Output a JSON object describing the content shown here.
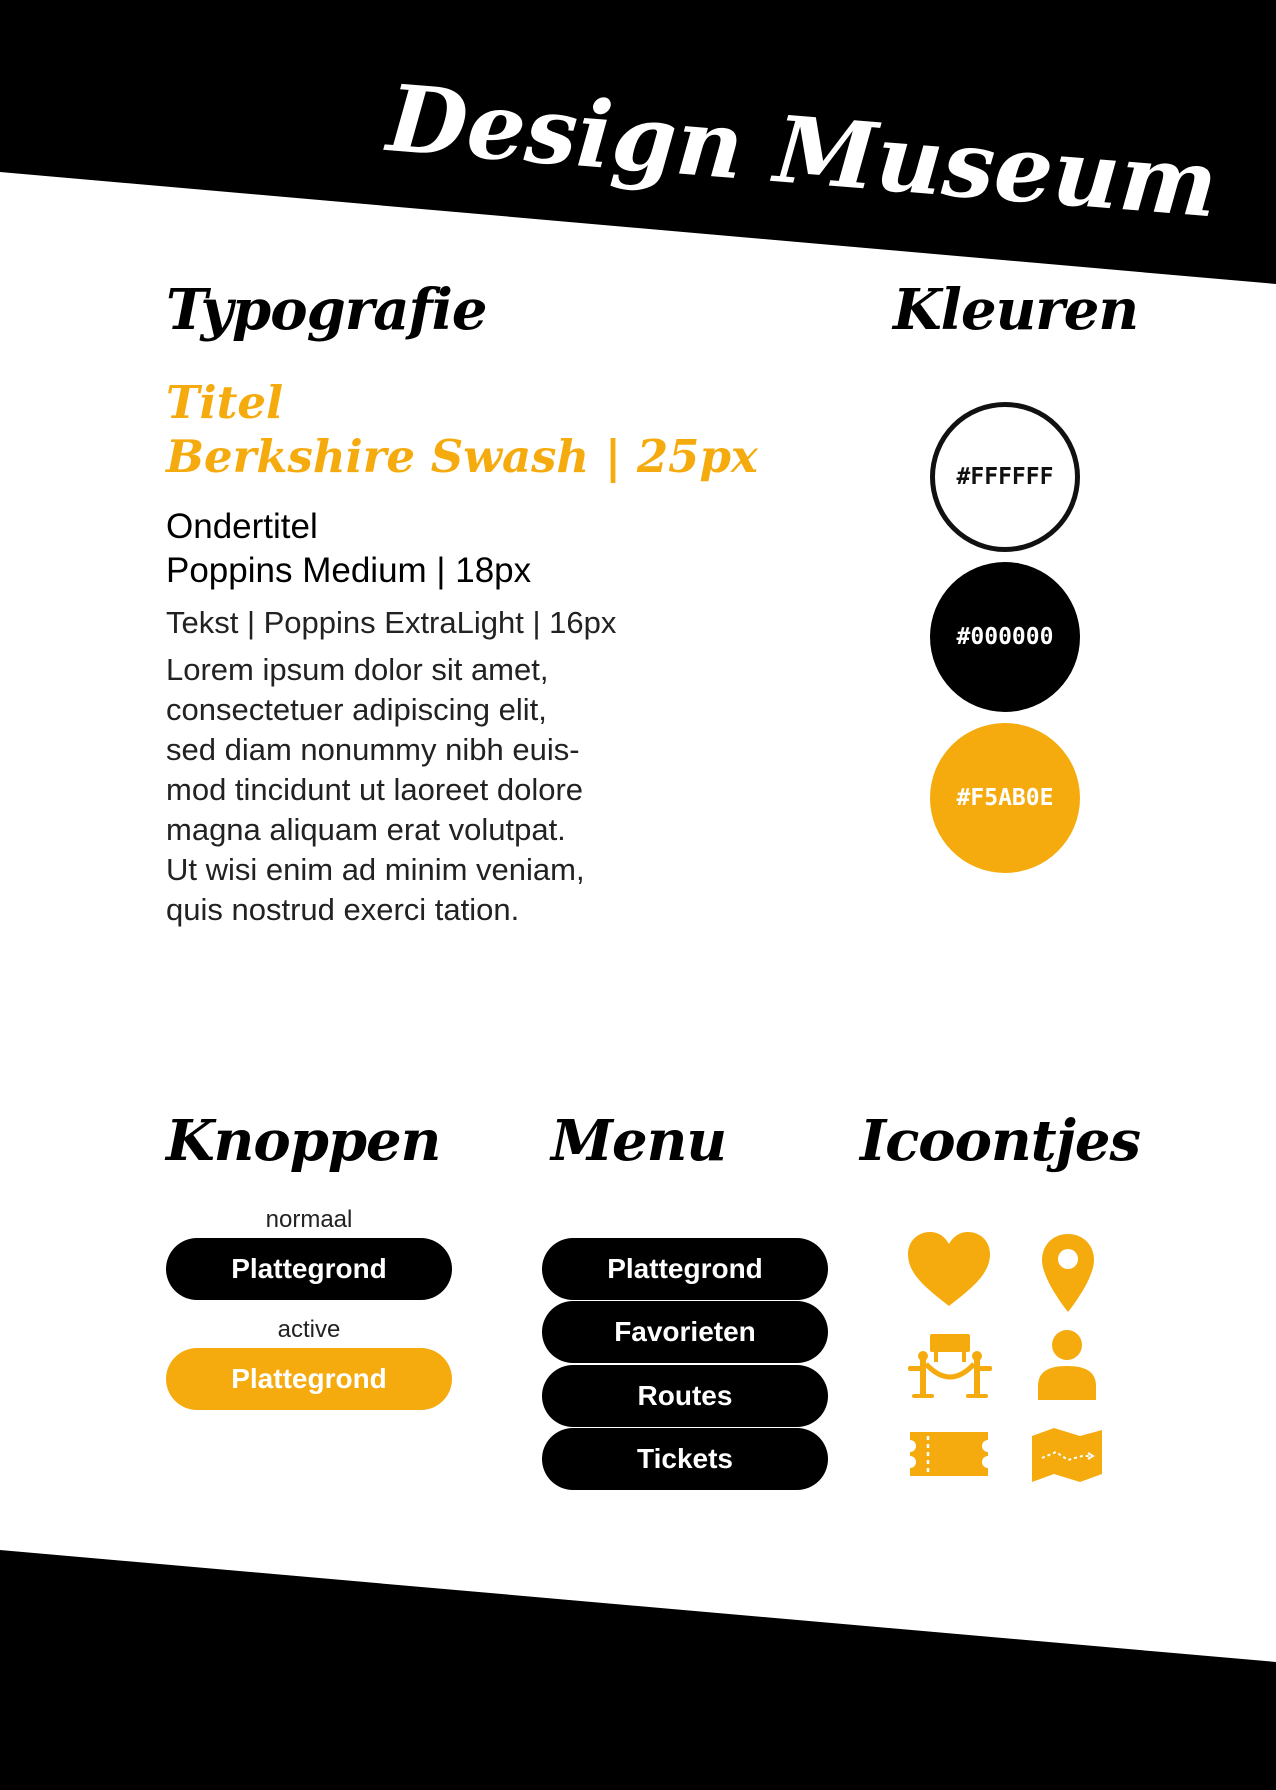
{
  "title": "Design Museum",
  "colors": {
    "black": "#000000",
    "white": "#FFFFFF",
    "accent": "#F5AB0E"
  },
  "typography": {
    "heading": "Typografie",
    "title_line1": "Titel",
    "title_line2": "Berkshire Swash | 25px",
    "subtitle_line1": "Ondertitel",
    "subtitle_line2": "Poppins Medium | 18px",
    "text_label": "Tekst | Poppins ExtraLight | 16px",
    "lorem_lines": [
      "Lorem ipsum dolor sit amet,",
      "consectetuer adipiscing elit,",
      "sed diam nonummy nibh euis-",
      "mod tincidunt ut laoreet dolore",
      "magna aliquam erat volutpat.",
      "Ut wisi enim ad minim veniam,",
      "quis nostrud exerci tation."
    ]
  },
  "kleuren": {
    "heading": "Kleuren",
    "swatches": [
      "#FFFFFF",
      "#000000",
      "#F5AB0E"
    ]
  },
  "knoppen": {
    "heading": "Knoppen",
    "normal_label": "normaal",
    "normal_button": "Plattegrond",
    "active_label": "active",
    "active_button": "Plattegrond"
  },
  "menu": {
    "heading": "Menu",
    "items": [
      "Plattegrond",
      "Favorieten",
      "Routes",
      "Tickets"
    ]
  },
  "icoontjes": {
    "heading": "Icoontjes",
    "icons": [
      "heart-icon",
      "location-pin-icon",
      "museum-rope-barrier-icon",
      "person-icon",
      "ticket-icon",
      "map-icon"
    ]
  }
}
